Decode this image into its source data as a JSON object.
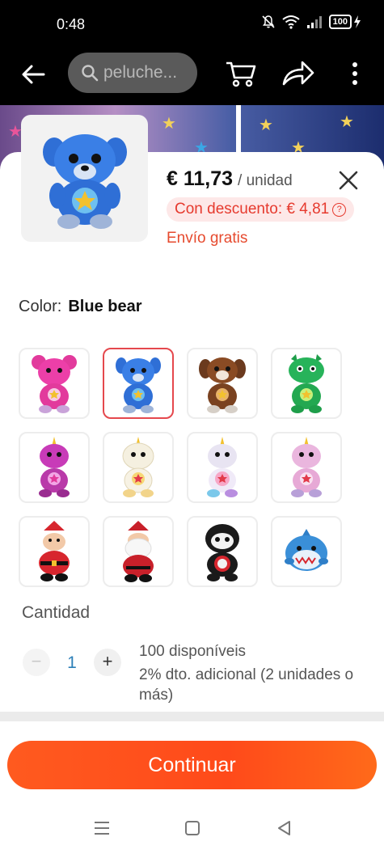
{
  "status_bar": {
    "time": "0:48",
    "battery": "100"
  },
  "app_bar": {
    "search_text": "peluche..."
  },
  "product": {
    "price": "€ 11,73",
    "unit": "/ unidad",
    "discount": "Con descuento: € 4,81",
    "shipping": "Envío gratis"
  },
  "color": {
    "label": "Color:",
    "selected": "Blue bear"
  },
  "quantity": {
    "label": "Cantidad",
    "value": "1",
    "minus": "−",
    "plus": "+",
    "stock": "100 disponíveis",
    "promo": "2% dto. adicional (2 unidades o más)"
  },
  "continue_label": "Continuar",
  "colors": {
    "accent": "#e63a2e",
    "button": "#ff5020",
    "selected_border": "#e5484d",
    "discount_bg": "#fde8e8"
  }
}
